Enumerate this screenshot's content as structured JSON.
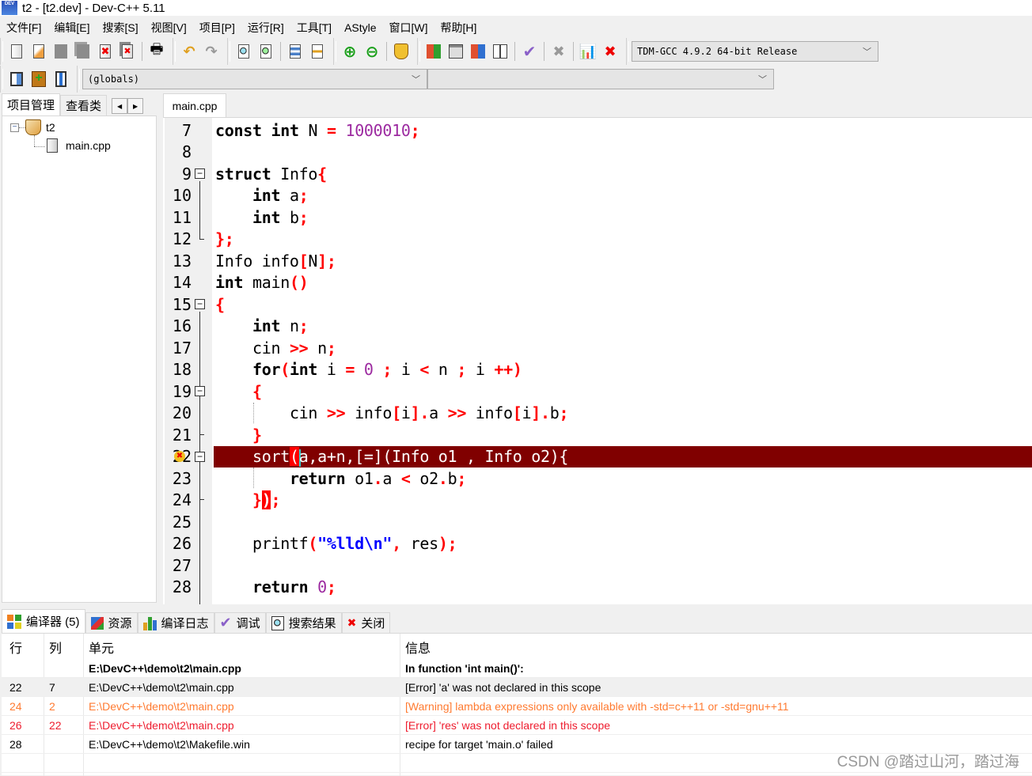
{
  "window": {
    "title": "t2 - [t2.dev] - Dev-C++ 5.11",
    "icon": "devcpp-app-icon",
    "icon_text": "DEV"
  },
  "menu": [
    "文件[F]",
    "编辑[E]",
    "搜索[S]",
    "视图[V]",
    "项目[P]",
    "运行[R]",
    "工具[T]",
    "AStyle",
    "窗口[W]",
    "帮助[H]"
  ],
  "toolbar": {
    "compiler_select": "TDM-GCC 4.9.2 64-bit Release",
    "globals_select": "(globals)",
    "members_select": ""
  },
  "left_panel": {
    "tabs": [
      "项目管理",
      "查看类"
    ],
    "tree": {
      "project": "t2",
      "files": [
        "main.cpp"
      ]
    }
  },
  "editor": {
    "tab": "main.cpp",
    "lines": [
      {
        "n": "7"
      },
      {
        "n": "8"
      },
      {
        "n": "9"
      },
      {
        "n": "10"
      },
      {
        "n": "11"
      },
      {
        "n": "12"
      },
      {
        "n": "13"
      },
      {
        "n": "14"
      },
      {
        "n": "15"
      },
      {
        "n": "16"
      },
      {
        "n": "17"
      },
      {
        "n": "18"
      },
      {
        "n": "19"
      },
      {
        "n": "20"
      },
      {
        "n": "21"
      },
      {
        "n": "22"
      },
      {
        "n": "23"
      },
      {
        "n": "24"
      },
      {
        "n": "25"
      },
      {
        "n": "26"
      },
      {
        "n": "27"
      },
      {
        "n": "28"
      }
    ],
    "error_line": "22",
    "code": {
      "l7": [
        "const",
        "int",
        "N",
        "=",
        "1000010",
        ";"
      ],
      "l9": [
        "struct",
        "Info",
        "{"
      ],
      "l10": [
        "int",
        "a",
        ";"
      ],
      "l11": [
        "int",
        "b",
        ";"
      ],
      "l12": [
        "};"
      ],
      "l13": [
        "Info info",
        "[",
        "N",
        "];"
      ],
      "l14": [
        "int",
        "main",
        "()"
      ],
      "l15": [
        "{"
      ],
      "l16": [
        "int",
        "n",
        ";"
      ],
      "l17": [
        "cin ",
        ">>",
        " n",
        ";"
      ],
      "l18": [
        "for",
        "(",
        "int",
        " i ",
        "=",
        " ",
        "0",
        " ",
        ";",
        " i ",
        "<",
        " n ",
        ";",
        " i ",
        "++",
        ")"
      ],
      "l19": [
        "{"
      ],
      "l20": [
        "cin ",
        ">>",
        " info",
        "[",
        "i",
        "].",
        "a ",
        ">>",
        " info",
        "[",
        "i",
        "].",
        "b",
        ";"
      ],
      "l21": [
        "}"
      ],
      "l22": [
        "sort",
        "(",
        "a,a+n,[=](Info o1 , Info o2){"
      ],
      "l23": [
        "return",
        " o1",
        ".",
        "a ",
        "<",
        " o2",
        ".",
        "b",
        ";"
      ],
      "l24": [
        "}",
        ")",
        ";"
      ],
      "l26": [
        "printf",
        "(",
        "\"%lld\\n\"",
        ",",
        " res",
        ");"
      ],
      "l28": [
        "return",
        " ",
        "0",
        ";"
      ]
    }
  },
  "bottom_panel": {
    "tabs": [
      {
        "label": "编译器 (5)",
        "icon": "compiler-grid-icon"
      },
      {
        "label": "资源",
        "icon": "resources-icon"
      },
      {
        "label": "编译日志",
        "icon": "bar-chart-icon"
      },
      {
        "label": "调试",
        "icon": "checkmark-icon"
      },
      {
        "label": "搜索结果",
        "icon": "search-results-icon"
      },
      {
        "label": "关闭",
        "icon": "close-file-icon"
      }
    ],
    "columns": [
      "行",
      "列",
      "单元",
      "信息"
    ],
    "rows": [
      {
        "line": "",
        "col": "",
        "unit": "E:\\DevC++\\demo\\t2\\main.cpp",
        "message": "In function 'int main()':",
        "type": "header"
      },
      {
        "line": "22",
        "col": "7",
        "unit": "E:\\DevC++\\demo\\t2\\main.cpp",
        "message": "[Error] 'a' was not declared in this scope",
        "type": "selected"
      },
      {
        "line": "24",
        "col": "2",
        "unit": "E:\\DevC++\\demo\\t2\\main.cpp",
        "message": "[Warning] lambda expressions only available with -std=c++11 or -std=gnu++11",
        "type": "warning"
      },
      {
        "line": "26",
        "col": "22",
        "unit": "E:\\DevC++\\demo\\t2\\main.cpp",
        "message": "[Error] 'res' was not declared in this scope",
        "type": "error"
      },
      {
        "line": "28",
        "col": "",
        "unit": "E:\\DevC++\\demo\\t2\\Makefile.win",
        "message": "recipe for target 'main.o' failed",
        "type": "normal"
      }
    ]
  },
  "colors": {
    "error_line_bg": "#800000",
    "warning_text": "#ff7a30",
    "error_text": "#ee1c2e",
    "keyword_symbol": "#ff0000",
    "number": "#9c2aa0",
    "string": "#0000ff"
  },
  "watermark": "CSDN @踏过山河，踏过海"
}
